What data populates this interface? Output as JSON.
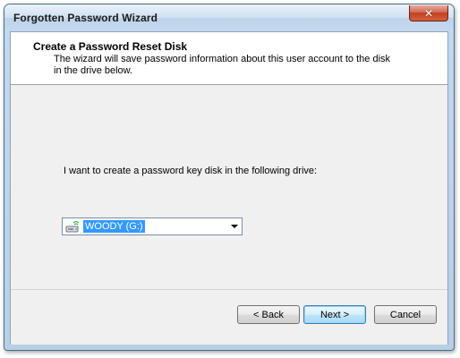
{
  "window": {
    "title": "Forgotten Password Wizard",
    "close_symbol": "✕"
  },
  "header": {
    "title": "Create a Password Reset Disk",
    "description": "The wizard will save password information about this user account to the disk in the drive below."
  },
  "body": {
    "prompt": "I want to create a password key disk in the following drive:",
    "drive_select": {
      "selected_value": "WOODY (G:)",
      "icon": "removable-drive-icon"
    }
  },
  "footer": {
    "back_label": "< Back",
    "next_label": "Next >",
    "cancel_label": "Cancel"
  },
  "colors": {
    "selection": "#3399ff",
    "close_button": "#c0401f",
    "default_button_border": "#3c7fb1"
  }
}
